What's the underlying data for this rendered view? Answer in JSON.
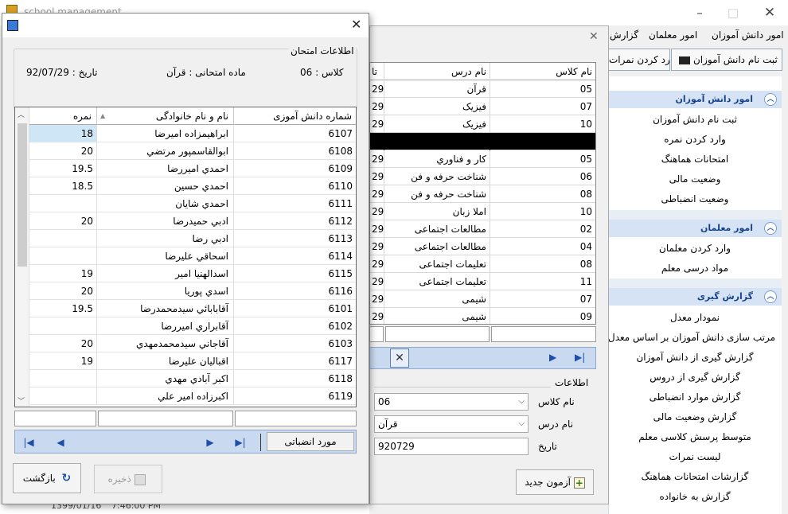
{
  "mainWindow": {
    "title": "school management",
    "taskbar_date": "1399/01/16",
    "taskbar_time": "7:46:00 PM"
  },
  "menu": [
    "امور دانش آموزان",
    "امور معلمان",
    "گزارش"
  ],
  "toolbar": {
    "register_student": "ثبت نام دانش آموزان",
    "enter_grade": "وارد کردن نمرات"
  },
  "navPanel": {
    "sections": [
      {
        "title": "امور دانش آموزان",
        "items": [
          "ثبت نام دانش آموزان",
          "وارد کردن نمره",
          "امتحانات هماهنگ",
          "وضعیت مالی",
          "وضعیت انضباطی"
        ]
      },
      {
        "title": "امور معلمان",
        "items": [
          "وارد کردن معلمان",
          "مواد درسی معلم"
        ]
      },
      {
        "title": "گزارش گیری",
        "items": [
          "نمودار معدل",
          "مرتب سازی دانش آموزان بر اساس معدل",
          "گزارش گیری از دانش آموزان",
          "گزارش گیری از دروس",
          "گزارش موارد انضباطی",
          "گزارش وضعیت مالی",
          "متوسط پرسش کلاسی معلم",
          "لیست نمرات",
          "گزارشات امتحانات هماهنگ",
          "گزارش به خانواده"
        ]
      }
    ]
  },
  "examWindow": {
    "headers": {
      "class": "نام کلاس",
      "lesson": "نام درس",
      "date": "تا"
    },
    "rows": [
      {
        "class": "05",
        "lesson": "قرآن",
        "date": "29"
      },
      {
        "class": "07",
        "lesson": "فیزیک",
        "date": "29"
      },
      {
        "class": "10",
        "lesson": "فیزیک",
        "date": "29"
      },
      {
        "class": "",
        "lesson": "",
        "date": ""
      },
      {
        "class": "05",
        "lesson": "کار و فناوري",
        "date": "29"
      },
      {
        "class": "06",
        "lesson": "شناخت حرفه و فن",
        "date": "29"
      },
      {
        "class": "08",
        "lesson": "شناخت حرفه و فن",
        "date": "29"
      },
      {
        "class": "10",
        "lesson": "املا زبان",
        "date": "29"
      },
      {
        "class": "02",
        "lesson": "مطالعات اجتماعی",
        "date": "29"
      },
      {
        "class": "04",
        "lesson": "مطالعات اجتماعی",
        "date": "29"
      },
      {
        "class": "08",
        "lesson": "تعلیمات اجتماعی",
        "date": "29"
      },
      {
        "class": "11",
        "lesson": "تعلیمات اجتماعی",
        "date": "29"
      },
      {
        "class": "07",
        "lesson": "شیمی",
        "date": "29"
      },
      {
        "class": "09",
        "lesson": "شیمی",
        "date": "29"
      }
    ],
    "info_title": "اطلاعات",
    "class_label": "نام کلاس",
    "class_value": "06",
    "lesson_label": "نام درس",
    "lesson_value": "قرآن",
    "date_label": "تاریخ",
    "date_value": "920729",
    "new_exam": "آزمون جدید"
  },
  "dialog": {
    "group_title": "اطلاعات امتحان",
    "class_text": "کلاس : 06",
    "lesson_text": "ماده امتحانی : قرآن",
    "date_text": "تاریخ : 92/07/29",
    "headers": {
      "student_no": "شماره دانش آموزی",
      "name": "نام و نام خانوادگی",
      "grade": "نمره"
    },
    "rows": [
      {
        "no": "6107",
        "name": "ابراهیمزاده  امیرضا",
        "grade": "18"
      },
      {
        "no": "6108",
        "name": "ابوالقاسمپور مرتضي",
        "grade": "20"
      },
      {
        "no": "6109",
        "name": "احمدي اميررضا",
        "grade": "19.5"
      },
      {
        "no": "6110",
        "name": "احمدي حسين",
        "grade": "18.5"
      },
      {
        "no": "6111",
        "name": "احمدي شايان",
        "grade": ""
      },
      {
        "no": "6112",
        "name": "ادبي  حميدرضا",
        "grade": "20"
      },
      {
        "no": "6113",
        "name": "ادبي  رضا",
        "grade": ""
      },
      {
        "no": "6114",
        "name": "اسحاقي  عليرضا",
        "grade": ""
      },
      {
        "no": "6115",
        "name": "اسدالهنيا امير",
        "grade": "19"
      },
      {
        "no": "6116",
        "name": "اسدي پوريا",
        "grade": "20"
      },
      {
        "no": "6101",
        "name": "آقابابائي سيدمحمدرضا",
        "grade": "19.5"
      },
      {
        "no": "6102",
        "name": "آقابراري  اميررضا",
        "grade": ""
      },
      {
        "no": "6103",
        "name": "آقاجاني سيدمحمدمهدي",
        "grade": "20"
      },
      {
        "no": "6117",
        "name": "اقباليان عليرضا",
        "grade": "19"
      },
      {
        "no": "6118",
        "name": "اكبر آبادي مهدي",
        "grade": ""
      },
      {
        "no": "6119",
        "name": "اكبرزاده امير علي",
        "grade": ""
      }
    ],
    "disciplinary": "مورد انضباتی",
    "save": "ذخیره",
    "back": "بازگشت"
  }
}
